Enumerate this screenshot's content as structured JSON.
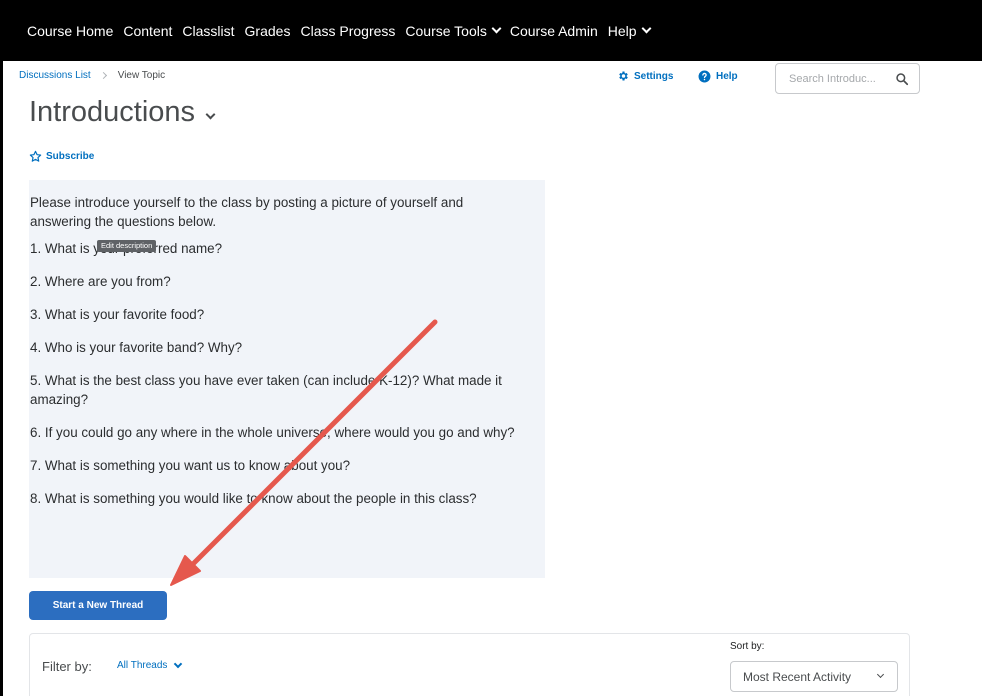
{
  "navbar": {
    "items": [
      {
        "label": "Course Home",
        "has_menu": false
      },
      {
        "label": "Content",
        "has_menu": false
      },
      {
        "label": "Classlist",
        "has_menu": false
      },
      {
        "label": "Grades",
        "has_menu": false
      },
      {
        "label": "Class Progress",
        "has_menu": false
      },
      {
        "label": "Course Tools",
        "has_menu": true
      },
      {
        "label": "Course Admin",
        "has_menu": false
      },
      {
        "label": "Help",
        "has_menu": true
      }
    ]
  },
  "breadcrumb": {
    "link": "Discussions List",
    "current": "View Topic"
  },
  "header_actions": {
    "settings_label": "Settings",
    "help_label": "Help",
    "settings_icon": "gear-icon",
    "help_icon": "question-circle-icon"
  },
  "search": {
    "placeholder": "Search Introduc...",
    "icon": "search-icon"
  },
  "topic": {
    "title": "Introductions",
    "subscribe_label": "Subscribe",
    "subscribe_icon": "star-outline-icon"
  },
  "description": {
    "intro": "Please introduce yourself to the class by posting a picture of yourself and answering the questions below.",
    "tooltip": "Edit description",
    "questions": [
      "1. What is your preferred name?",
      "2. Where are you from?",
      "3. What is your favorite food?",
      "4. Who is your favorite band? Why?",
      "5. What is the best class you have ever taken (can include K-12)? What made it amazing?",
      "6. If you could go any where in the whole universe, where would you go and why?",
      "7. What is something you want us to know about you?",
      "8. What is something you would like to know about the people in this class?"
    ]
  },
  "actions": {
    "start_thread_label": "Start a New Thread"
  },
  "filter": {
    "label": "Filter by:",
    "value": "All Threads",
    "sort_label": "Sort by:",
    "sort_value": "Most Recent Activity"
  },
  "colors": {
    "nav_background": "#000000",
    "link_blue": "#006fbf",
    "primary_button": "#2c6ec0",
    "description_background": "#f1f4f9",
    "annotation_arrow": "#e5584d"
  }
}
